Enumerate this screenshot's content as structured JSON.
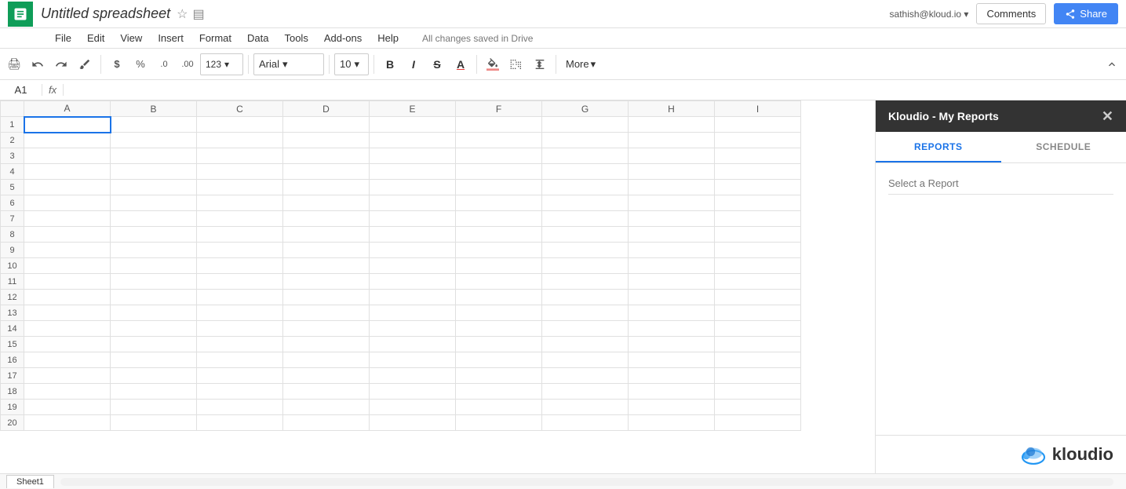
{
  "topbar": {
    "title": "Untitled spreadsheet",
    "star_icon": "☆",
    "folder_icon": "▤",
    "user_email": "sathish@kloud.io ▾",
    "comments_label": "Comments",
    "share_label": "Share"
  },
  "menubar": {
    "items": [
      "File",
      "Edit",
      "View",
      "Insert",
      "Format",
      "Data",
      "Tools",
      "Add-ons",
      "Help"
    ],
    "autosave": "All changes saved in Drive"
  },
  "toolbar": {
    "print": "🖨",
    "undo": "↩",
    "redo": "↪",
    "paint": "🖌",
    "currency": "$",
    "percent": "%",
    "decimal_dec": ".0",
    "decimal_inc": ".00",
    "format_123": "123",
    "font_name": "Arial",
    "font_size": "10",
    "bold": "B",
    "italic": "I",
    "strikethrough": "S̶",
    "font_color": "A",
    "fill_color": "◇",
    "borders": "⊞",
    "merge": "⊟",
    "more_label": "More",
    "expand": "⌃"
  },
  "formula_bar": {
    "cell_name": "A1",
    "fx_label": "fx"
  },
  "grid": {
    "col_headers": [
      "A",
      "B",
      "C",
      "D",
      "E",
      "F",
      "G",
      "H",
      "I"
    ],
    "rows": 20,
    "active_cell": {
      "row": 1,
      "col": 0
    }
  },
  "side_panel": {
    "title": "Kloudio - My Reports",
    "close_icon": "✕",
    "tabs": [
      "REPORTS",
      "SCHEDULE"
    ],
    "active_tab": "REPORTS",
    "select_report_placeholder": "Select a Report",
    "logo_text": "kloudio",
    "logo_icon": "cloud"
  },
  "bottom_bar": {
    "sheet_name": "Sheet1"
  }
}
